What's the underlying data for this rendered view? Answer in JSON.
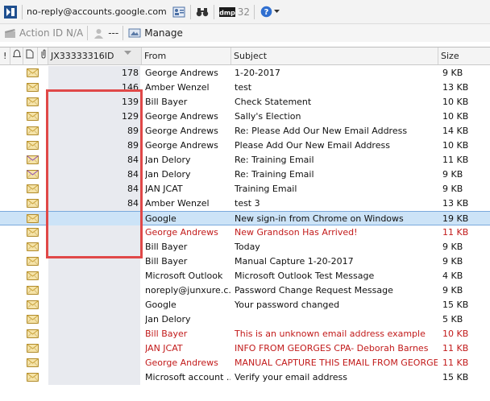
{
  "toolbar": {
    "sender": "no-reply@accounts.google.com",
    "count": "32",
    "action_id": "Action ID N/A",
    "user_value": "---",
    "manage_label": "Manage"
  },
  "columns": {
    "id": "JX33333316ID",
    "from": "From",
    "subject": "Subject",
    "size": "Size"
  },
  "rows": [
    {
      "id": "178",
      "from": "George Andrews",
      "subject": "1-20-2017",
      "size": "9 KB"
    },
    {
      "id": "146",
      "from": "Amber Wenzel",
      "subject": "test",
      "size": "13 KB"
    },
    {
      "id": "139",
      "from": "Bill Bayer",
      "subject": "Check Statement",
      "size": "10 KB"
    },
    {
      "id": "129",
      "from": "George Andrews",
      "subject": "Sally's Election",
      "size": "10 KB"
    },
    {
      "id": "89",
      "from": "George Andrews",
      "subject": "Re: Please Add Our New Email Address",
      "size": "14 KB"
    },
    {
      "id": "89",
      "from": "George Andrews",
      "subject": "Please Add Our New Email Address",
      "size": "10 KB"
    },
    {
      "id": "84",
      "from": "Jan Delory",
      "subject": "Re: Training Email",
      "size": "11 KB"
    },
    {
      "id": "84",
      "from": "Jan Delory",
      "subject": "Re: Training Email",
      "size": "9 KB"
    },
    {
      "id": "84",
      "from": "JAN JCAT",
      "subject": "Training Email",
      "size": "9 KB"
    },
    {
      "id": "84",
      "from": "Amber Wenzel",
      "subject": "test 3",
      "size": "13 KB"
    },
    {
      "id": "",
      "from": "Google",
      "subject": "New sign-in from Chrome on Windows",
      "size": "19 KB"
    },
    {
      "id": "",
      "from": "George Andrews",
      "subject": "New Grandson Has Arrived!",
      "size": "11 KB"
    },
    {
      "id": "",
      "from": "Bill Bayer",
      "subject": "Today",
      "size": "9 KB"
    },
    {
      "id": "",
      "from": "Bill Bayer",
      "subject": "Manual Capture 1-20-2017",
      "size": "9 KB"
    },
    {
      "id": "",
      "from": "Microsoft Outlook",
      "subject": "Microsoft Outlook Test Message",
      "size": "4 KB"
    },
    {
      "id": "",
      "from": "noreply@junxure.c...",
      "subject": "Password Change Request Message",
      "size": "9 KB"
    },
    {
      "id": "",
      "from": "Google",
      "subject": "Your password changed",
      "size": "15 KB"
    },
    {
      "id": "",
      "from": "Jan Delory",
      "subject": "",
      "size": "5 KB"
    },
    {
      "id": "",
      "from": "Bill Bayer",
      "subject": "This is an unknown email address example",
      "size": "10 KB"
    },
    {
      "id": "",
      "from": "JAN JCAT",
      "subject": "INFO FROM GEORGES CPA- Deborah Barnes",
      "size": "11 KB"
    },
    {
      "id": "",
      "from": "George Andrews",
      "subject": "MANUAL CAPTURE THIS EMAIL FROM GEORGE",
      "size": "11 KB"
    },
    {
      "id": "",
      "from": "Microsoft account ...",
      "subject": "Verify your email address",
      "size": "15 KB"
    }
  ],
  "colors": {
    "unknown_sender": "#c21a1a",
    "selected_row": "#cce3f7",
    "highlight_box": "#e04848"
  }
}
